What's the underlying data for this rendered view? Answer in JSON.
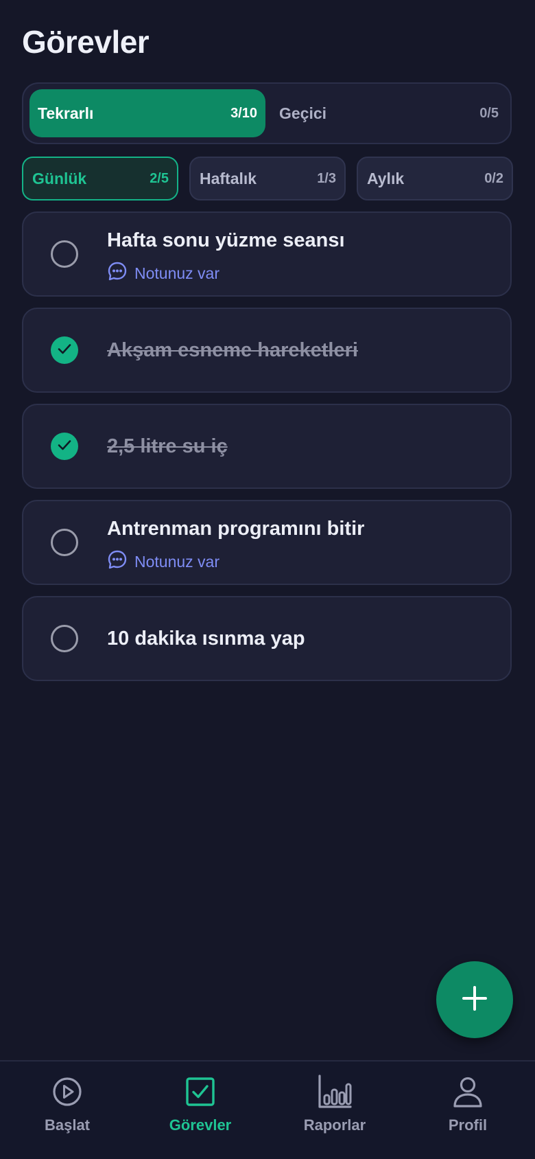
{
  "header": {
    "title": "Görevler"
  },
  "segment": {
    "active": {
      "label": "Tekrarlı",
      "count": "3/10"
    },
    "inactive": {
      "label": "Geçici",
      "count": "0/5"
    }
  },
  "period_tabs": [
    {
      "label": "Günlük",
      "count": "2/5",
      "active": true
    },
    {
      "label": "Haftalık",
      "count": "1/3",
      "active": false
    },
    {
      "label": "Aylık",
      "count": "0/2",
      "active": false
    }
  ],
  "tasks": [
    {
      "title": "Hafta sonu yüzme seansı",
      "done": false,
      "note": "Notunuz var"
    },
    {
      "title": "Akşam esneme hareketleri",
      "done": true,
      "note": ""
    },
    {
      "title": "2,5 litre su iç",
      "done": true,
      "note": ""
    },
    {
      "title": "Antrenman programını bitir",
      "done": false,
      "note": "Notunuz var"
    },
    {
      "title": "10 dakika ısınma yap",
      "done": false,
      "note": ""
    }
  ],
  "fab": {
    "icon": "plus-icon"
  },
  "bottom_nav": [
    {
      "label": "Başlat",
      "icon": "play-circle-icon",
      "active": false
    },
    {
      "label": "Görevler",
      "icon": "checkbox-icon",
      "active": true
    },
    {
      "label": "Raporlar",
      "icon": "bar-chart-icon",
      "active": false
    },
    {
      "label": "Profil",
      "icon": "user-icon",
      "active": false
    }
  ],
  "colors": {
    "background": "#151728",
    "accent": "#0d8a64",
    "accent_text": "#1fc493",
    "note": "#7f8df5"
  }
}
